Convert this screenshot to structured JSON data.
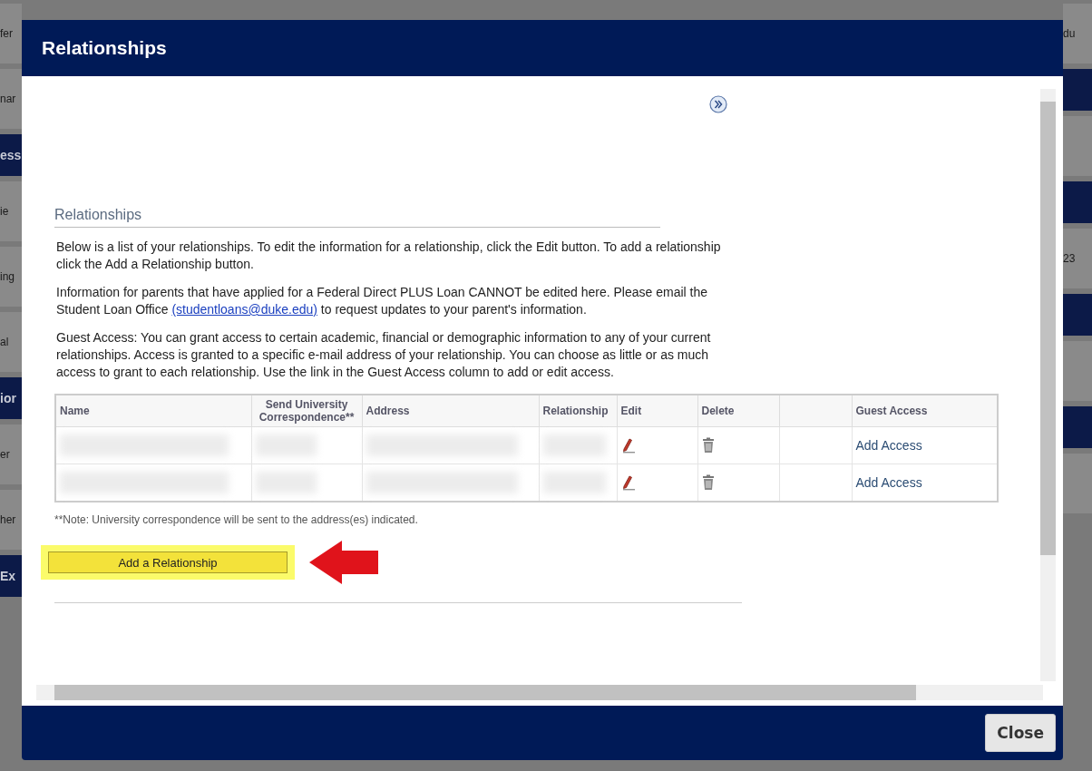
{
  "background": {
    "left_items": [
      {
        "kind": "row",
        "text": "fer"
      },
      {
        "kind": "row",
        "text": "nar"
      },
      {
        "kind": "band",
        "text": "ess"
      },
      {
        "kind": "row",
        "text": "ie"
      },
      {
        "kind": "row",
        "text": "ing"
      },
      {
        "kind": "row",
        "text": "al"
      },
      {
        "kind": "band",
        "text": "ior"
      },
      {
        "kind": "row",
        "text": "er"
      },
      {
        "kind": "row",
        "text": "her"
      },
      {
        "kind": "band",
        "text": "Ex"
      }
    ],
    "right_items": [
      {
        "kind": "row",
        "text": "du"
      },
      {
        "kind": "band"
      },
      {
        "kind": "row"
      },
      {
        "kind": "band"
      },
      {
        "kind": "row",
        "text": "23"
      },
      {
        "kind": "band"
      },
      {
        "kind": "row"
      },
      {
        "kind": "band"
      },
      {
        "kind": "row"
      }
    ]
  },
  "dialog": {
    "title": "Relationships",
    "section_title": "Relationships",
    "paragraphs": [
      {
        "text": "Below is a list of your relationships. To edit the information for a relationship, click the Edit button. To add a relationship click the Add a Relationship button."
      },
      {
        "text": "Information for parents that have applied for a Federal Direct PLUS Loan CANNOT be edited here. Please email the Student Loan Office ",
        "link": "(studentloans@duke.edu)",
        "after": " to request updates to your parent's information."
      },
      {
        "text": "Guest Access: You can grant access to certain academic, financial or demographic information to any of your current relationships. Access is granted to a specific e-mail address of your relationship. You can choose as little or as much access to grant to each relationship. Use the link in the Guest Access column to add or edit access."
      }
    ],
    "table": {
      "columns": [
        {
          "kind": "text",
          "label": "Name"
        },
        {
          "kind": "text",
          "label": "Send University Correspondence**"
        },
        {
          "kind": "text",
          "label": "Address"
        },
        {
          "kind": "text",
          "label": "Relationship"
        },
        {
          "kind": "text",
          "label": "Edit"
        },
        {
          "kind": "text",
          "label": "Delete"
        },
        {
          "kind": "blank"
        },
        {
          "kind": "text",
          "label": "Guest Access"
        }
      ],
      "rows": [
        {
          "guest_access": "Add Access"
        },
        {
          "guest_access": "Add Access"
        }
      ]
    },
    "note": "**Note: University correspondence will be sent to the address(es) indicated.",
    "add_button": "Add a Relationship",
    "close_button": "Close"
  }
}
